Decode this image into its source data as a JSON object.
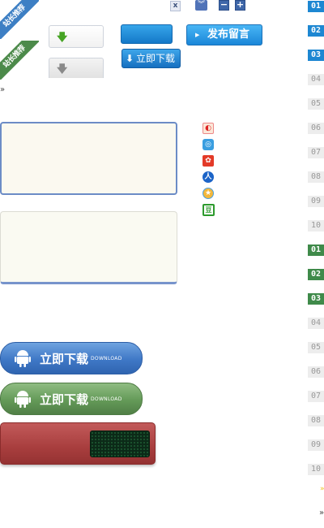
{
  "ribbons": {
    "blue_text": "站长推荐",
    "green_text": "站长推荐"
  },
  "toolbar": {
    "close_label": "x",
    "collapse_label": "»",
    "minus_label": "−",
    "plus_label": "+"
  },
  "arrow_boxes": [
    {
      "glyph": "🡇"
    },
    {
      "glyph": "🡇"
    }
  ],
  "buttons": {
    "post_label": "发布留言",
    "post_glyph": "▶",
    "download_label": "立即下载",
    "download_glyph": "⬇"
  },
  "raquo": "»",
  "share_icons": [
    "微博",
    "腾讯",
    "人人",
    "开心",
    "星",
    "豆"
  ],
  "share_glyphs": {
    "weibo": "◐",
    "qzone": "◎",
    "renren": "✿",
    "kaixin": "人",
    "star": "★",
    "douban": "豆"
  },
  "pills": [
    {
      "label": "立即下载",
      "sub": "DOWNLOAD",
      "color": "#3f78c6"
    },
    {
      "label": "立即下载",
      "sub": "DOWNLOAD",
      "color": "#649a58"
    }
  ],
  "numbers_blue": [
    "01",
    "02",
    "03",
    "04",
    "05",
    "06",
    "07",
    "08",
    "09",
    "10"
  ],
  "numbers_green": [
    "01",
    "02",
    "03",
    "04",
    "05",
    "06",
    "07",
    "08",
    "09",
    "10"
  ],
  "bottom_marks": {
    "dot": "»",
    "raquo": "»"
  }
}
